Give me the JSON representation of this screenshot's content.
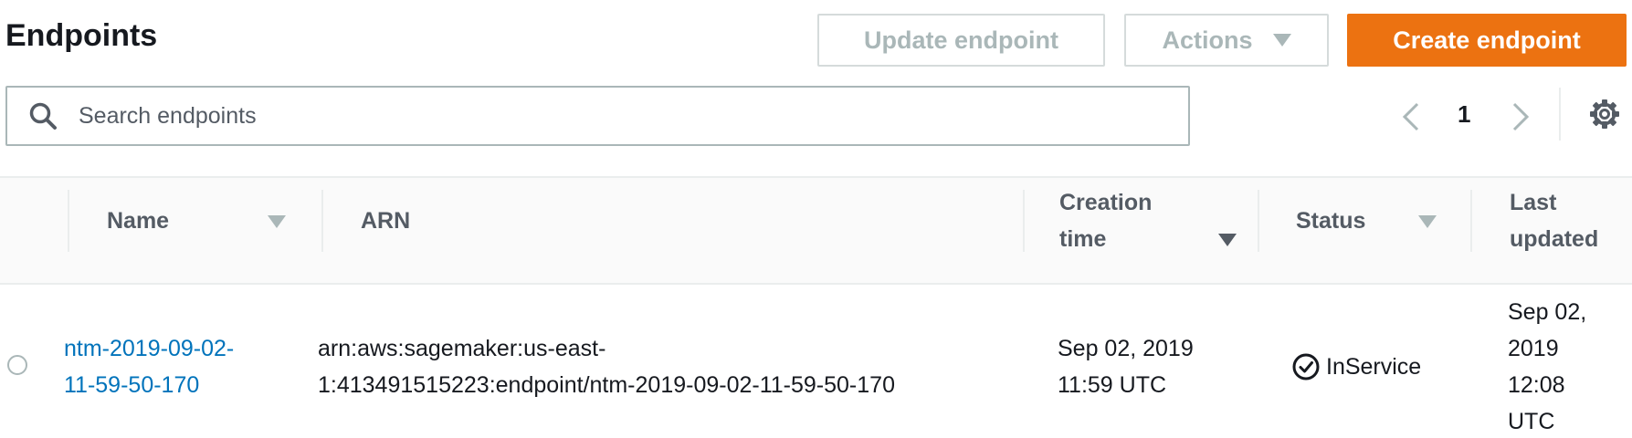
{
  "header": {
    "title": "Endpoints",
    "update_label": "Update endpoint",
    "actions_label": "Actions",
    "create_label": "Create endpoint"
  },
  "search": {
    "placeholder": "Search endpoints",
    "value": ""
  },
  "pagination": {
    "current_page": "1"
  },
  "table": {
    "columns": {
      "name": "Name",
      "arn": "ARN",
      "creation_time_line1": "Creation",
      "creation_time_line2": "time",
      "status": "Status",
      "last_updated_line1": "Last",
      "last_updated_line2": "updated"
    },
    "rows": [
      {
        "name_line1": "ntm-2019-09-02-",
        "name_line2": "11-59-50-170",
        "arn_line1": "arn:aws:sagemaker:us-east-",
        "arn_line2": "1:413491515223:endpoint/ntm-2019-09-02-11-59-50-170",
        "creation_line1": "Sep 02, 2019",
        "creation_line2": "11:59 UTC",
        "status": "InService",
        "updated_line1": "Sep 02,",
        "updated_line2": "2019",
        "updated_line3": "12:08",
        "updated_line4": "UTC"
      }
    ]
  },
  "colors": {
    "accent": "#ec7211",
    "link": "#0073bb",
    "disabled_text": "#aab7b8",
    "border": "#eaeded"
  },
  "icons": {
    "search": "search-icon",
    "prev": "chevron-left-icon",
    "next": "chevron-right-icon",
    "settings": "gear-icon",
    "status": "check-circle-icon",
    "sort": "caret-down-icon"
  }
}
